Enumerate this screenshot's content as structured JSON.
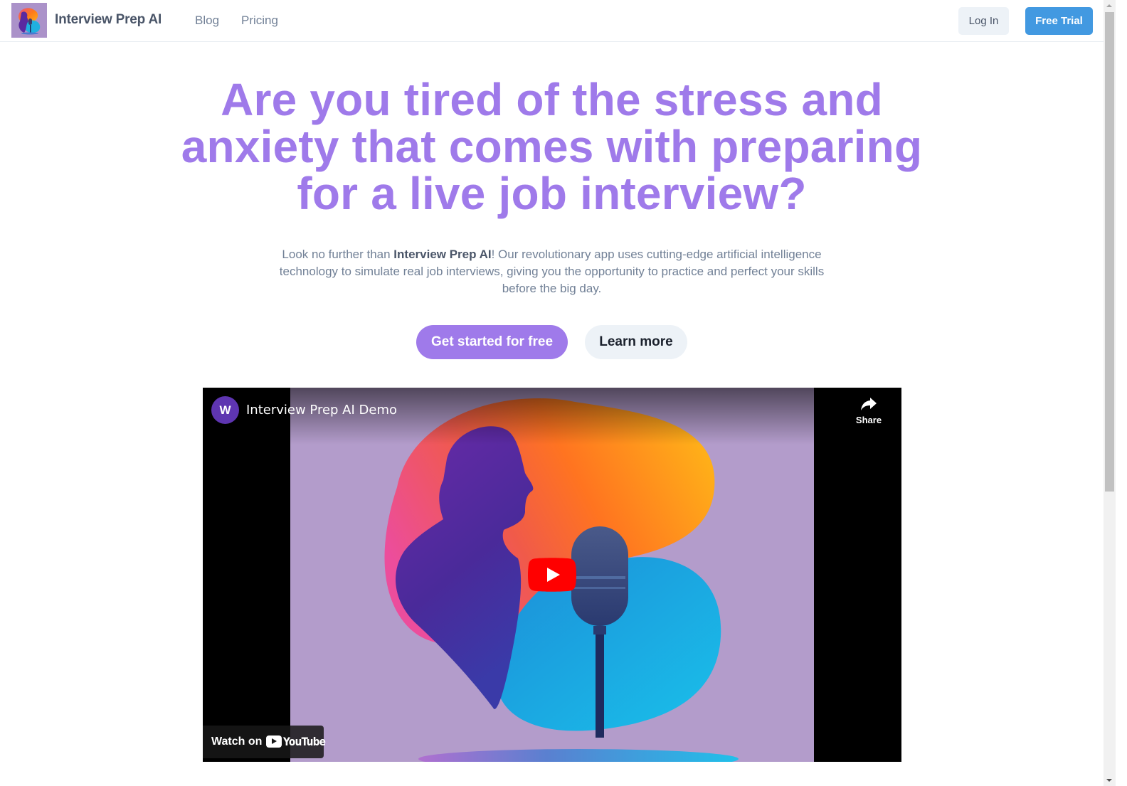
{
  "nav": {
    "brand": "Interview Prep AI",
    "links": [
      "Blog",
      "Pricing"
    ],
    "login_label": "Log In",
    "trial_label": "Free Trial"
  },
  "hero": {
    "title_lines": [
      "Are you tired of the stress and",
      "anxiety that comes with preparing",
      "for a live job interview?"
    ],
    "subtitle_prefix": "Look no further than ",
    "subtitle_bold": "Interview Prep AI",
    "subtitle_suffix": "! Our revolutionary app uses cutting-edge artificial intelligence technology to simulate real job interviews, giving you the opportunity to practice and perfect your skills before the big day.",
    "primary_cta": "Get started for free",
    "secondary_cta": "Learn more"
  },
  "video": {
    "channel_initial": "W",
    "title": "Interview Prep AI Demo",
    "share_label": "Share",
    "watch_on_label": "Watch on",
    "platform_label": "YouTube"
  },
  "colors": {
    "accent_purple": "#9f7aea",
    "trial_blue": "#4299e1",
    "youtube_red": "#ff0000"
  }
}
